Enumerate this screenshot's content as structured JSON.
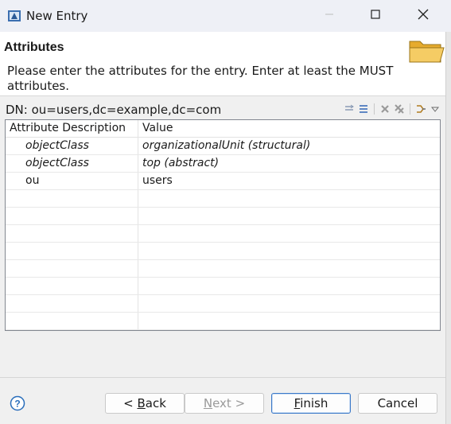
{
  "window": {
    "title": "New Entry",
    "icon": "ldap-entry-icon"
  },
  "header": {
    "title": "Attributes",
    "description": "Please enter the attributes for the entry. Enter at least the MUST attributes.",
    "icon": "folder-icon"
  },
  "dn": {
    "label": "DN: ou=users,dc=example,dc=com"
  },
  "toolbar": {
    "icons": [
      "expand-all-icon",
      "collapse-all-icon",
      "delete-icon",
      "delete-all-icon",
      "filter-icon",
      "view-menu-icon"
    ]
  },
  "table": {
    "headers": {
      "description": "Attribute Description",
      "value": "Value"
    },
    "rows": [
      {
        "description": "objectClass",
        "value": "organizationalUnit (structural)",
        "italic": true
      },
      {
        "description": "objectClass",
        "value": "top (abstract)",
        "italic": true
      },
      {
        "description": "ou",
        "value": "users",
        "italic": false
      }
    ],
    "empty_rows": 8
  },
  "buttons": {
    "back": {
      "prefix": "< ",
      "mnemonic": "B",
      "rest": "ack"
    },
    "next": {
      "mnemonic": "N",
      "rest": "ext",
      "suffix": " >"
    },
    "finish": {
      "mnemonic": "F",
      "rest": "inish"
    },
    "cancel": "Cancel"
  },
  "colors": {
    "accent": "#3a78c8",
    "help": "#2a6ebb",
    "folder": "#f0c04e"
  }
}
